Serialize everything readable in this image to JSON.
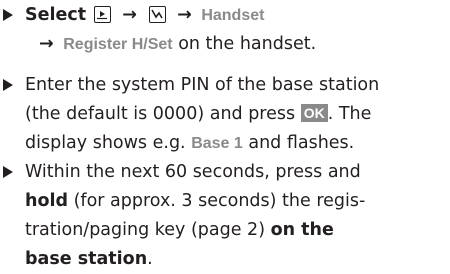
{
  "steps": [
    {
      "select_word": "Select",
      "arrow": "→",
      "menu_handset": "Handset",
      "menu_register": "Register H/Set",
      "on_handset": " on the handset."
    },
    {
      "line1": "Enter the system PIN of the base station",
      "line2_a": "(the default is 0000) and press ",
      "ok_key": "OK",
      "line2_b": ". The",
      "line3_a": "display shows e.g. ",
      "base_display": "Base 1",
      "line3_b": " and flashes."
    },
    {
      "line1": "Within the next 60 seconds, press and",
      "hold_word": "hold",
      "line2_b": " (for approx. 3 seconds) the regis-",
      "line3": "tration/paging key (page 2) ",
      "on_the": "on the",
      "base_station": "base station",
      "period": "."
    }
  ],
  "icons": {
    "menu_icon_1": "open-menu-icon",
    "menu_icon_2": "settings-menu-icon",
    "bullet": "triangle-bullet-icon"
  }
}
